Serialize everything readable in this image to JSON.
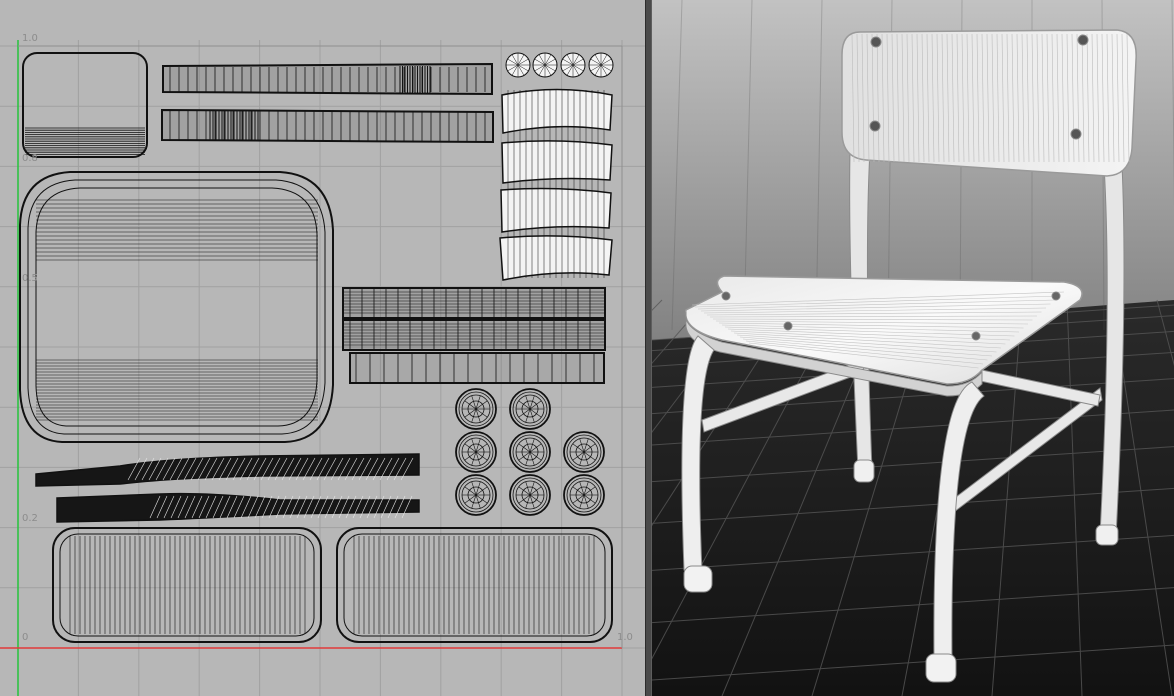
{
  "uv_editor": {
    "axis_labels": {
      "top_left": "1.0",
      "mid_upper": "0.8",
      "mid": "0.5",
      "lower": "0.2",
      "origin": "0",
      "right": "1.0"
    },
    "colors": {
      "background": "#b7b7b7",
      "grid": "#a3a3a3",
      "u_axis": "#e23a3a",
      "v_axis": "#27c43c",
      "wire": "#111111"
    }
  },
  "viewport": {
    "object": "school-chair",
    "colors": {
      "sky_top": "#b9b9b9",
      "sky_bottom": "#6e6e6e",
      "floor": "#1c1c1c",
      "grid": "#5a5a5a",
      "model": "#ececec"
    }
  }
}
